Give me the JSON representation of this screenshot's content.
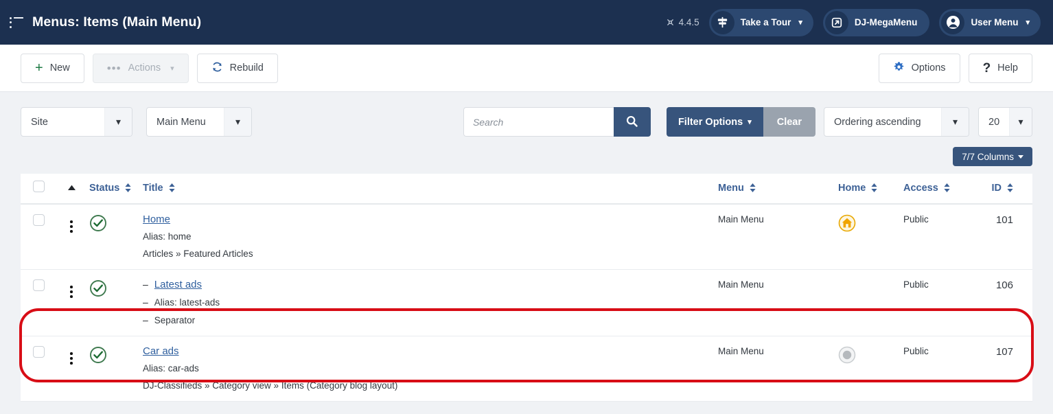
{
  "header": {
    "menu_icon": "list-menu-icon",
    "title": "Menus: Items (Main Menu)",
    "version": "4.4.5",
    "joomla_icon": "joomla-logo-icon",
    "tour_button": {
      "label": "Take a Tour",
      "icon": "signpost-icon",
      "caret": "⌄"
    },
    "megamenu_button": {
      "label": "DJ-MegaMenu",
      "icon": "external-link-icon"
    },
    "user_button": {
      "label": "User Menu",
      "icon": "user-circle-icon",
      "caret": "⌄"
    }
  },
  "toolbar": {
    "new_label": "New",
    "new_icon": "plus-icon",
    "actions_label": "Actions",
    "actions_icon": "ellipsis-icon",
    "actions_caret": "⌄",
    "rebuild_label": "Rebuild",
    "rebuild_icon": "refresh-icon",
    "options_label": "Options",
    "options_icon": "gear-icon",
    "help_label": "Help",
    "help_icon": "question-mark-icon"
  },
  "filters": {
    "site_select": {
      "value": "Site",
      "caret": "⌄"
    },
    "menu_select": {
      "value": "Main Menu",
      "caret": "⌄"
    },
    "search": {
      "value": "",
      "placeholder": "Search",
      "button_icon": "search-icon"
    },
    "filter_options_label": "Filter Options",
    "filter_options_caret": "⌄",
    "clear_label": "Clear",
    "ordering_select": {
      "value": "Ordering ascending",
      "caret": "⌄"
    },
    "limit_select": {
      "value": "20",
      "caret": "⌄"
    },
    "columns_badge": "7/7 Columns"
  },
  "table": {
    "columns": {
      "select_all": "select-all-checkbox",
      "ordering_icon": "sort-ascending-arrow",
      "status": "Status",
      "title": "Title",
      "menu": "Menu",
      "home": "Home",
      "access": "Access",
      "id": "ID"
    },
    "rows": [
      {
        "checkbox": false,
        "actions_icon": "vertical-dots-icon",
        "status_icon": "check-circle-icon",
        "status": "published",
        "title": "Home",
        "level": 0,
        "alias": "Alias: home",
        "path": "Articles » Featured Articles",
        "menu": "Main Menu",
        "home": "yes",
        "home_icon": "home-circle-icon",
        "access": "Public",
        "id": "101",
        "highlighted": false
      },
      {
        "checkbox": false,
        "actions_icon": "vertical-dots-icon",
        "status_icon": "check-circle-icon",
        "status": "published",
        "title": "Latest ads",
        "level": 1,
        "dash": "–",
        "alias": "Alias: latest-ads",
        "path": "Separator",
        "menu": "Main Menu",
        "home": "none",
        "access": "Public",
        "id": "106",
        "highlighted": false
      },
      {
        "checkbox": false,
        "actions_icon": "vertical-dots-icon",
        "status_icon": "check-circle-icon",
        "status": "published",
        "title": "Car ads",
        "level": 0,
        "alias": "Alias: car-ads",
        "path": "DJ-Classifieds » Category view » Items (Category blog layout)",
        "menu": "Main Menu",
        "home": "no",
        "home_icon": "grey-circle-icon",
        "access": "Public",
        "id": "107",
        "highlighted": true
      }
    ]
  },
  "colors": {
    "header_bg": "#1c3050",
    "accent_blue": "#37547c",
    "link_blue": "#2f5f9e",
    "status_green": "#3f7a4f",
    "home_amber": "#e8a700",
    "highlight_red": "#d80d16",
    "clear_grey": "#9aa3ae"
  }
}
